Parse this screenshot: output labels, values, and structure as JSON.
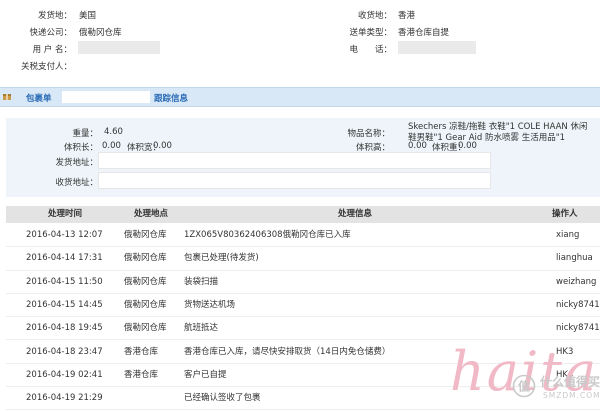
{
  "order": {
    "ship_from_label": "发货地：",
    "ship_from": "美国",
    "ship_to_label": "收货地：",
    "ship_to": "香港",
    "courier_label": "快递公司：",
    "courier": "俄勒冈仓库",
    "delivery_type_label": "送单类型：",
    "delivery_type": "香港仓库自提",
    "username_label": "用 户 名：",
    "username": "",
    "phone_label": "电　　话：",
    "phone": "",
    "tax_payer_label": "关税支付人：",
    "tax_payer": ""
  },
  "package_section": {
    "title_prefix": "包裹单",
    "tracking_number": "",
    "title_suffix": "跟踪信息"
  },
  "package": {
    "weight_label": "重量：",
    "weight": "4.60",
    "product_label": "物品名称：",
    "product": "Skechers 凉鞋/拖鞋 衣鞋\"1 COLE HAAN 休闲鞋男鞋\"1 Gear Aid 防水喷雾 生活用品\"1",
    "volume_length_label": "体积长：",
    "volume_length": "0.00",
    "volume_width_label": "体积宽：",
    "volume_width": "0.00",
    "volume_height_label": "体积高：",
    "volume_height": "0.00",
    "volume_weight_label": "体积重：",
    "volume_weight": "0.00",
    "sender_address_label": "发货地址：",
    "receiver_address_label": "收货地址："
  },
  "tracking_table": {
    "headers": [
      "处理时间",
      "处理地点",
      "处理信息",
      "操作人"
    ],
    "rows": [
      {
        "time": "2016-04-13 12:07",
        "location": "俄勒冈仓库",
        "info": "1ZX065V80362406308俄勒冈仓库已入库",
        "operator": "xiang"
      },
      {
        "time": "2016-04-14 17:31",
        "location": "俄勒冈仓库",
        "info": "包裹已处理(待发货)",
        "operator": "lianghua"
      },
      {
        "time": "2016-04-15 11:50",
        "location": "俄勒冈仓库",
        "info": "装袋扫描",
        "operator": "weizhang"
      },
      {
        "time": "2016-04-15 14:45",
        "location": "俄勒冈仓库",
        "info": "货物送达机场",
        "operator": "nicky8741"
      },
      {
        "time": "2016-04-18 19:45",
        "location": "俄勒冈仓库",
        "info": "航班抵达",
        "operator": "nicky8741"
      },
      {
        "time": "2016-04-18 23:47",
        "location": "香港仓库",
        "info": "香港仓库已入库，请尽快安排取货（14日内免仓储费）",
        "operator": "HK3"
      },
      {
        "time": "2016-04-19 02:41",
        "location": "香港仓库",
        "info": "客户已自提",
        "operator": "HK4"
      },
      {
        "time": "2016-04-19 21:29",
        "location": "",
        "info": "已经确认签收了包裹",
        "operator": ""
      }
    ]
  },
  "watermark": {
    "brand": "什么值得买",
    "domain": "SMZDM.COM",
    "handwriting": "haitai"
  }
}
